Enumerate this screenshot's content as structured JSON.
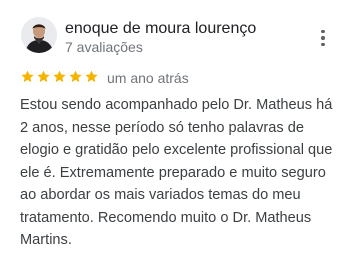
{
  "review": {
    "reviewer_name": "enoque de moura lourenço",
    "review_count": "7 avaliações",
    "rating": 5,
    "date": "um ano atrás",
    "text": "Estou sendo acompanhado pelo Dr. Matheus há 2 anos, nesse período só tenho palavras de elogio e gratidão pelo excelente profissional que ele é. Extremamente preparado e muito seguro ao abordar os mais variados temas do meu tratamento. Recomendo muito o Dr. Matheus Martins.",
    "more_icon": "more-vert-icon",
    "star_icon": "star-icon"
  },
  "colors": {
    "star": "#f4b400",
    "secondary_text": "#70757a",
    "body_text": "#3c4043"
  }
}
